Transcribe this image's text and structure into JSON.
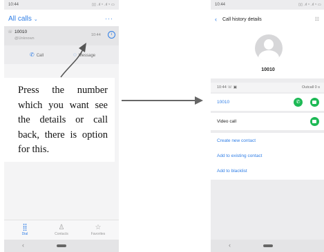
{
  "left_screen": {
    "status": {
      "time": "10:44",
      "icons": "▯▯ .ıl ᵛ .ıl ᵛ ▭"
    },
    "header": {
      "title": "All calls",
      "chevron": "⌄",
      "more": "···"
    },
    "call_entry": {
      "number": "10010",
      "location": "@Unknown",
      "time": "10:44",
      "info_glyph": "i",
      "phone_glyph": "☏"
    },
    "actions": {
      "call": "Call",
      "message": "Message"
    },
    "tabs": [
      {
        "label": "Dial",
        "glyph": "⣿"
      },
      {
        "label": "Contacts",
        "glyph": "♙"
      },
      {
        "label": "Favorites",
        "glyph": "☆"
      }
    ],
    "nav": {
      "back": "‹"
    }
  },
  "callout": {
    "text": "Press the number which you want see the details or call back, there is option for this."
  },
  "right_screen": {
    "status": {
      "time": "10:44",
      "icons": "▯▯ .ıl ᵛ .ıl ᵛ ▭"
    },
    "header": {
      "back": "‹",
      "title": "Call history details",
      "menu": "☷"
    },
    "contact": {
      "name": "10010"
    },
    "log": {
      "time": "10:44 ☏ ▣",
      "status": "Outcall 0 s"
    },
    "number_row": {
      "number": "10010"
    },
    "video_row": {
      "label": "Video call"
    },
    "links": {
      "create": "Create new contact",
      "existing": "Add to existing contact",
      "blacklist": "Add to blacklist"
    },
    "nav": {
      "back": "‹"
    }
  },
  "colors": {
    "accent": "#2f7ee6",
    "green": "#1db955",
    "arrow": "#666666"
  }
}
